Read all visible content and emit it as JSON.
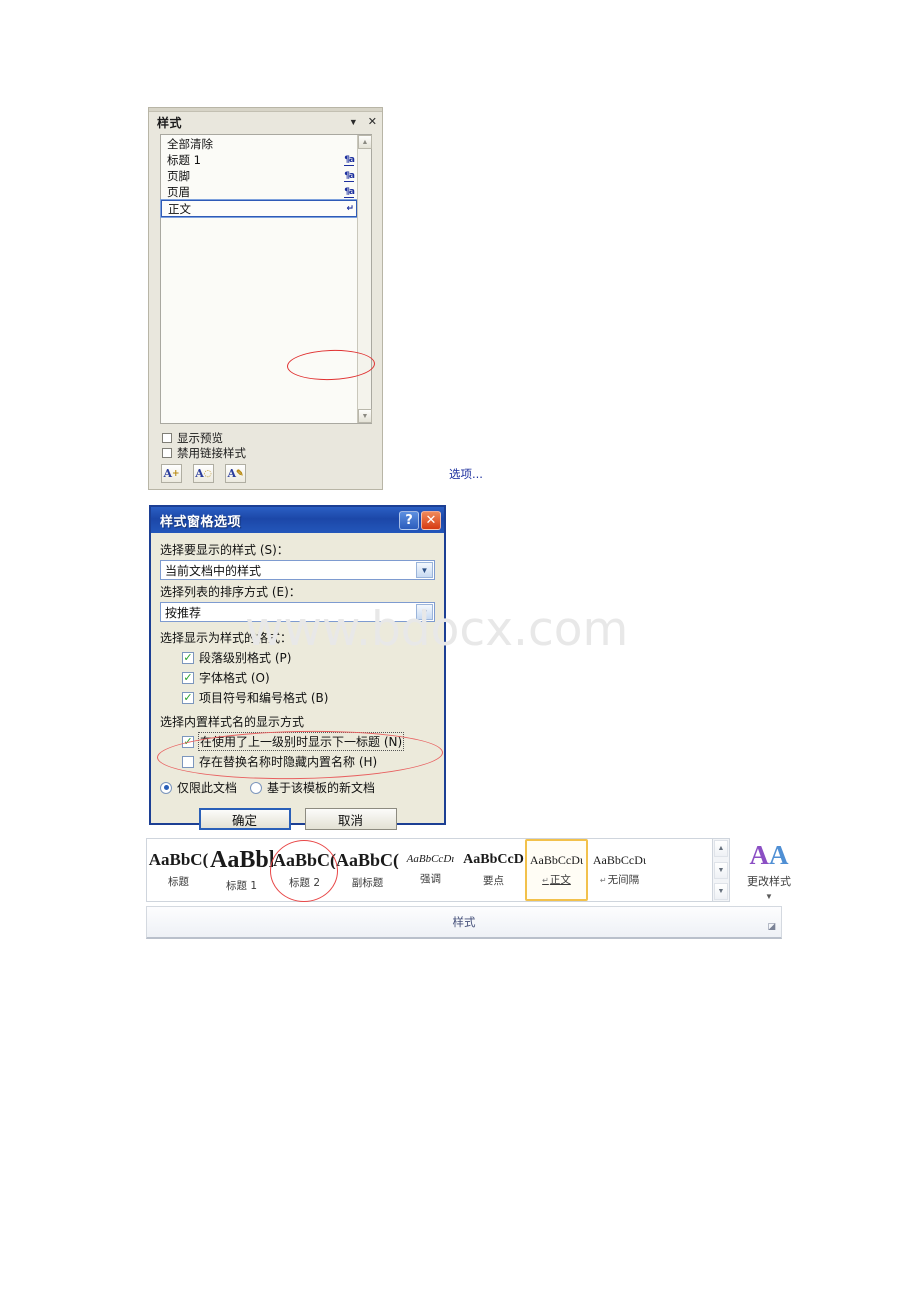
{
  "watermark": {
    "text": "www.bdocx.com"
  },
  "styles_pane": {
    "title": "样式",
    "collapse_icon": "▼",
    "close_icon": "✕",
    "list": [
      {
        "label": "全部清除",
        "mark": "",
        "selected": false
      },
      {
        "label": "标题 1",
        "mark": "¶a",
        "selected": false
      },
      {
        "label": "页脚",
        "mark": "¶a",
        "selected": false
      },
      {
        "label": "页眉",
        "mark": "¶a",
        "selected": false
      },
      {
        "label": "正文",
        "mark": "↵",
        "selected": true
      }
    ],
    "checkboxes": [
      {
        "label": "显示预览",
        "checked": false
      },
      {
        "label": "禁用链接样式",
        "checked": false
      }
    ],
    "toolbar_buttons": [
      {
        "name": "new-style-button",
        "glyph": "A"
      },
      {
        "name": "style-inspector-button",
        "glyph": "A"
      },
      {
        "name": "manage-styles-button",
        "glyph": "A"
      }
    ],
    "options_link": "选项..."
  },
  "dialog": {
    "title": "样式窗格选项",
    "help_icon": "?",
    "close_icon": "✕",
    "field1_label": "选择要显示的样式 (S)：",
    "field1_value": "当前文档中的样式",
    "field2_label": "选择列表的排序方式 (E)：",
    "field2_value": "按推荐",
    "format_section_label": "选择显示为样式的格式：",
    "format_checks": [
      {
        "label": "段落级别格式 (P)",
        "checked": true
      },
      {
        "label": "字体格式 (O)",
        "checked": true
      },
      {
        "label": "项目符号和编号格式 (B)",
        "checked": true
      }
    ],
    "builtin_section_label": "选择内置样式名的显示方式",
    "builtin_checks": [
      {
        "label": "在使用了上一级别时显示下一标题 (N)",
        "checked": true,
        "focused": true
      },
      {
        "label": "存在替换名称时隐藏内置名称 (H)",
        "checked": false,
        "focused": false
      }
    ],
    "radios": [
      {
        "label": "仅限此文档",
        "selected": true
      },
      {
        "label": "基于该模板的新文档",
        "selected": false
      }
    ],
    "ok_button": "确定",
    "cancel_button": "取消"
  },
  "ribbon": {
    "gallery": [
      {
        "sample": "AaBbC(",
        "name": "标题",
        "pmark": "",
        "selected": false,
        "cls": "s-title"
      },
      {
        "sample": "AaBbl",
        "name": "标题 1",
        "pmark": "",
        "selected": false,
        "cls": "s-h1"
      },
      {
        "sample": "AaBbC(",
        "name": "标题 2",
        "pmark": "",
        "selected": false,
        "cls": "s-h2"
      },
      {
        "sample": "AaBbC(",
        "name": "副标题",
        "pmark": "",
        "selected": false,
        "cls": "s-sub"
      },
      {
        "sample": "AaBbCcDı",
        "name": "强调",
        "pmark": "",
        "selected": false,
        "cls": "s-em"
      },
      {
        "sample": "AaBbCcD",
        "name": "要点",
        "pmark": "",
        "selected": false,
        "cls": "s-strong"
      },
      {
        "sample": "AaBbCcDι",
        "name": "正文",
        "pmark": "↵",
        "selected": true,
        "cls": "s-normal"
      },
      {
        "sample": "AaBbCcDι",
        "name": "无间隔",
        "pmark": "↵",
        "selected": false,
        "cls": "s-nospace"
      }
    ],
    "scroll_up": "▲",
    "scroll_down": "▼",
    "scroll_more": "▼",
    "change_styles_label": "更改样式",
    "change_styles_caret": "▼",
    "group_name": "样式",
    "dialog_launcher": "◪"
  }
}
